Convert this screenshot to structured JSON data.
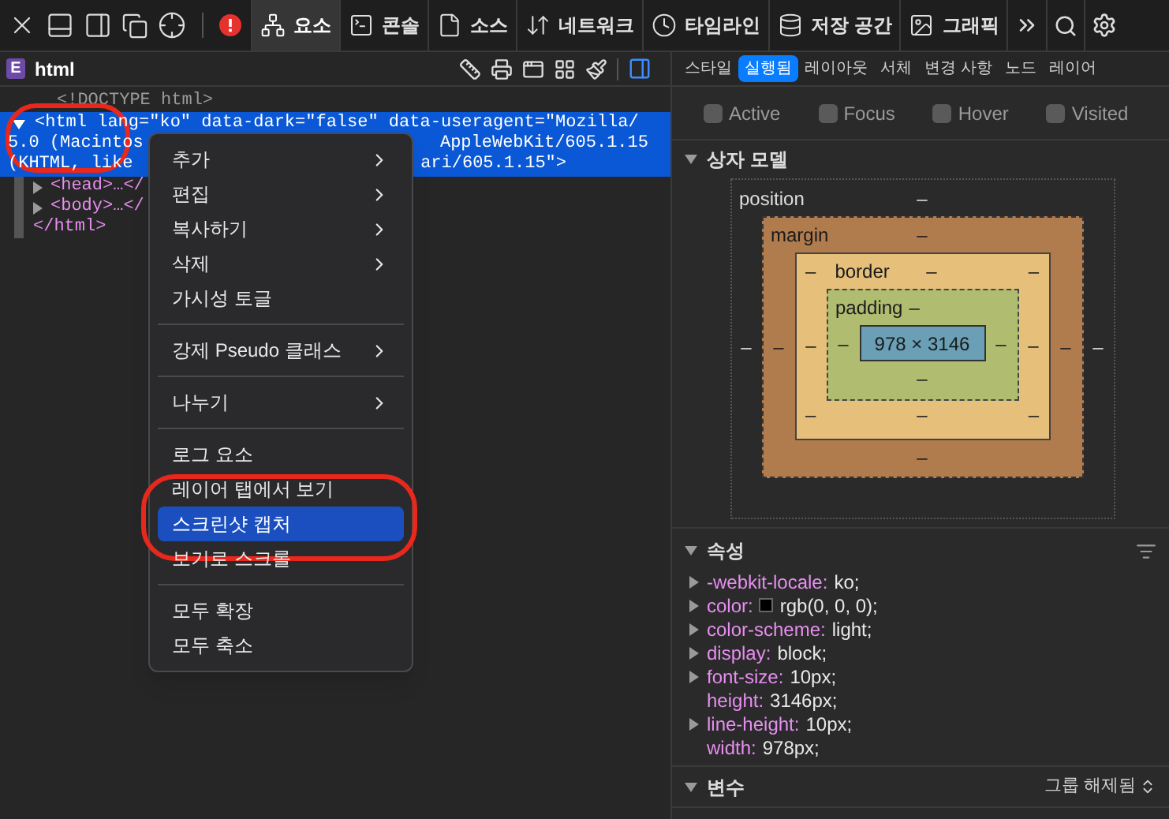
{
  "toolbar": {
    "tabs": [
      {
        "label": "요소",
        "selected": true
      },
      {
        "label": "콘솔",
        "selected": false
      },
      {
        "label": "소스",
        "selected": false
      },
      {
        "label": "네트워크",
        "selected": false
      },
      {
        "label": "타임라인",
        "selected": false
      },
      {
        "label": "저장 공간",
        "selected": false
      },
      {
        "label": "그래픽",
        "selected": false
      }
    ]
  },
  "breadcrumb": {
    "badge": "E",
    "label": "html"
  },
  "dom_tree": {
    "doctype": "<!DOCTYPE html>",
    "selected_element": {
      "selected": true,
      "expanded": true,
      "lines": [
        {
          "left": "<html lang=\"ko\" data-dark=\"false\" data-useragent=\"Mozilla/"
        },
        {
          "left": "5.0 (Macintos",
          "right": "AppleWebKit/605.1.15"
        },
        {
          "left": "(KHTML, like",
          "right": "ari/605.1.15\">"
        }
      ]
    },
    "children": [
      {
        "text": "<head>…</",
        "expanded": false
      },
      {
        "text": "<body>…</",
        "expanded": false
      }
    ],
    "closing": "</html>"
  },
  "context_menu": {
    "groups": [
      [
        {
          "label": "추가",
          "submenu": true,
          "selected": false
        },
        {
          "label": "편집",
          "submenu": true,
          "selected": false
        },
        {
          "label": "복사하기",
          "submenu": true,
          "selected": false
        },
        {
          "label": "삭제",
          "submenu": true,
          "selected": false
        },
        {
          "label": "가시성 토글",
          "submenu": false,
          "selected": false
        }
      ],
      [
        {
          "label": "강제 Pseudo 클래스",
          "submenu": true,
          "selected": false
        }
      ],
      [
        {
          "label": "나누기",
          "submenu": true,
          "selected": false
        }
      ],
      [
        {
          "label": "로그 요소",
          "submenu": false,
          "selected": false
        },
        {
          "label": "레이어 탭에서 보기",
          "submenu": false,
          "selected": false
        },
        {
          "label": "스크린샷 캡처",
          "submenu": false,
          "selected": true
        },
        {
          "label": "보기로 스크롤",
          "submenu": false,
          "selected": false
        }
      ],
      [
        {
          "label": "모두 확장",
          "submenu": false,
          "selected": false
        },
        {
          "label": "모두 축소",
          "submenu": false,
          "selected": false
        }
      ]
    ]
  },
  "sidebar_tabs": [
    {
      "label": "스타일",
      "selected": false
    },
    {
      "label": "실행됨",
      "selected": true
    },
    {
      "label": "레이아웃",
      "selected": false
    },
    {
      "label": "서체",
      "selected": false
    },
    {
      "label": "변경 사항",
      "selected": false
    },
    {
      "label": "노드",
      "selected": false
    },
    {
      "label": "레이어",
      "selected": false
    }
  ],
  "pseudo_classes": [
    {
      "label": "Active",
      "checked": false
    },
    {
      "label": "Focus",
      "checked": false
    },
    {
      "label": "Hover",
      "checked": false
    },
    {
      "label": "Visited",
      "checked": false
    }
  ],
  "box_model": {
    "title": "상자 모델",
    "expanded": true,
    "position": {
      "label": "position",
      "top": "–",
      "left": "–",
      "right": "–"
    },
    "margin": {
      "label": "margin",
      "top": "–",
      "left": "–",
      "right": "–",
      "bottom": "–"
    },
    "border": {
      "label": "border",
      "top": "–",
      "left": "–",
      "right": "–",
      "bottom": "–",
      "top_left": "–",
      "top_right": "–",
      "bottom_left": "–",
      "bottom_right": "–"
    },
    "padding": {
      "label": "padding",
      "top": "–",
      "left": "–",
      "right": "–",
      "bottom": "–"
    },
    "content": "978 × 3146"
  },
  "properties": {
    "title": "속성",
    "expanded": true,
    "items": [
      {
        "name": "-webkit-locale:",
        "value": "ko;",
        "expandable": true
      },
      {
        "name": "color:",
        "value": "rgb(0, 0, 0);",
        "expandable": true,
        "color": "#000000"
      },
      {
        "name": "color-scheme:",
        "value": "light;",
        "expandable": true
      },
      {
        "name": "display:",
        "value": "block;",
        "expandable": true
      },
      {
        "name": "font-size:",
        "value": "10px;",
        "expandable": true
      },
      {
        "name": "height:",
        "value": "3146px;",
        "expandable": false
      },
      {
        "name": "line-height:",
        "value": "10px;",
        "expandable": true
      },
      {
        "name": "width:",
        "value": "978px;",
        "expandable": false
      }
    ]
  },
  "variables": {
    "title": "변수",
    "expanded": true,
    "grouping": "그룹 해제됨"
  }
}
